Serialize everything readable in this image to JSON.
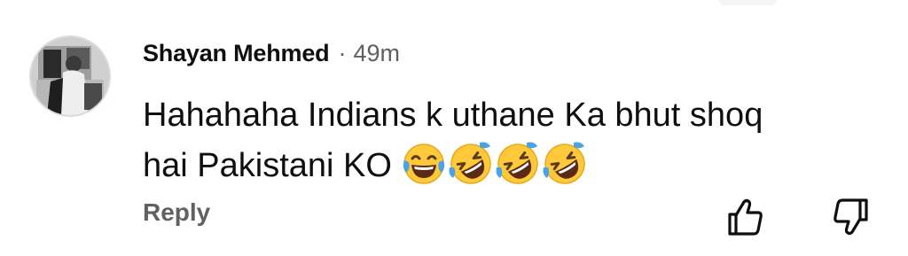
{
  "comment": {
    "author": "Shayan Mehmed",
    "separator": "·",
    "time": "49m",
    "text_line1": "Hahahaha Indians k uthane Ka bhut shoq",
    "text_line2": "hai Pakistani KO",
    "emojis": [
      "face-with-tears-of-joy",
      "rolling-on-the-floor-laughing",
      "rolling-on-the-floor-laughing",
      "rolling-on-the-floor-laughing"
    ],
    "reply_label": "Reply"
  },
  "actions": {
    "like_icon": "thumbs-up-icon",
    "dislike_icon": "thumbs-down-icon"
  },
  "colors": {
    "text_primary": "#0f0f0f",
    "text_secondary": "#606060",
    "emoji_yellow": "#ffc93a",
    "emoji_tears": "#4aa3e8"
  }
}
